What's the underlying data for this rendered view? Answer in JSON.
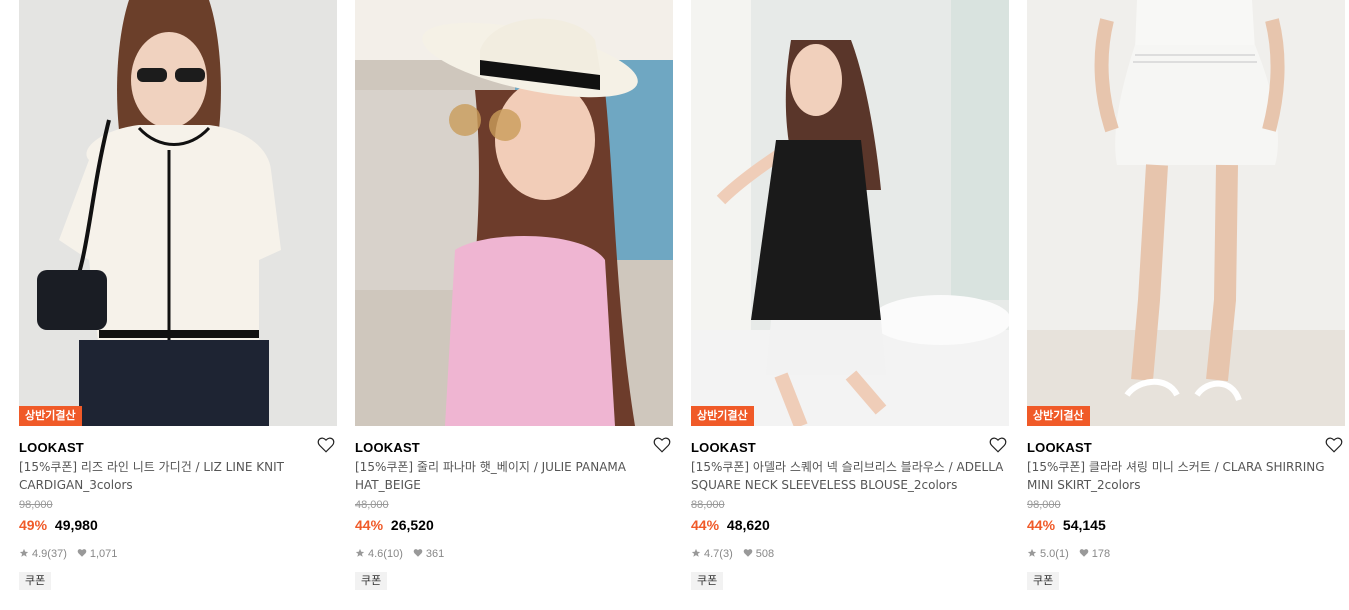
{
  "products": [
    {
      "badge": "상반기결산",
      "brand": "LOOKAST",
      "name": "[15%쿠폰] 리즈 라인 니트 가디건 / LIZ LINE KNIT CARDIGAN_3colors",
      "original_price": "98,000",
      "discount": "49%",
      "price": "49,980",
      "rating": "4.9",
      "reviews": "(37)",
      "likes": "1,071",
      "coupon": "쿠폰"
    },
    {
      "badge": "",
      "brand": "LOOKAST",
      "name": "[15%쿠폰] 줄리 파나마 햇_베이지 / JULIE PANAMA HAT_BEIGE",
      "original_price": "48,000",
      "discount": "44%",
      "price": "26,520",
      "rating": "4.6",
      "reviews": "(10)",
      "likes": "361",
      "coupon": "쿠폰"
    },
    {
      "badge": "상반기결산",
      "brand": "LOOKAST",
      "name": "[15%쿠폰] 아델라 스퀘어 넥 슬리브리스 블라우스 / ADELLA SQUARE NECK SLEEVELESS BLOUSE_2colors",
      "original_price": "88,000",
      "discount": "44%",
      "price": "48,620",
      "rating": "4.7",
      "reviews": "(3)",
      "likes": "508",
      "coupon": "쿠폰"
    },
    {
      "badge": "상반기결산",
      "brand": "LOOKAST",
      "name": "[15%쿠폰] 클라라 셔링 미니 스커트 / CLARA SHIRRING MINI SKIRT_2colors",
      "original_price": "98,000",
      "discount": "44%",
      "price": "54,145",
      "rating": "5.0",
      "reviews": "(1)",
      "likes": "178",
      "coupon": "쿠폰"
    }
  ],
  "colors": {
    "accent": "#f05a28",
    "muted": "#888888"
  },
  "icons": {
    "wishlist": "heart-outline-icon",
    "rating": "star-icon",
    "likes": "heart-filled-icon"
  }
}
